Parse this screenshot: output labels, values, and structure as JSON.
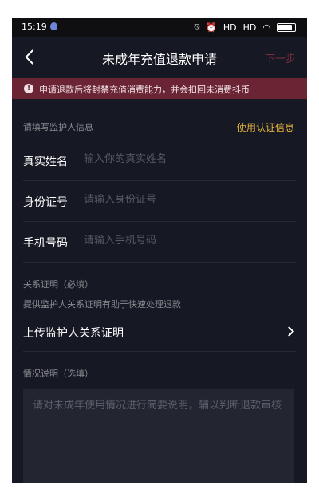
{
  "status_bar": {
    "time": "15:19",
    "signal1": "HD",
    "signal2": "HD"
  },
  "nav": {
    "title": "未成年充值退款申请",
    "next_label": "下一步",
    "back_icon": "chevron-left-icon"
  },
  "warning": {
    "text": "申请退款后将封禁充值消费能力，并会扣回未消费抖币",
    "icon": "!"
  },
  "guardian": {
    "section_label": "请填写监护人信息",
    "use_cert_label": "使用认证信息",
    "fields": [
      {
        "label": "真实姓名",
        "placeholder": "输入你的真实姓名"
      },
      {
        "label": "身份证号",
        "placeholder": "请输入身份证号"
      },
      {
        "label": "手机号码",
        "placeholder": "请输入手机号码"
      }
    ]
  },
  "relation": {
    "title": "关系证明（必填）",
    "hint": "提供监护人关系证明有助于快速处理退款",
    "upload_label": "上传监护人关系证明"
  },
  "situation": {
    "title": "情况说明（选填）",
    "placeholder": "请对未成年使用情况进行简要说明，辅以判断退款审核"
  },
  "colors": {
    "background": "#161823",
    "accent": "#e7b53d",
    "warning_bg": "#6b2434",
    "next_disabled": "#7a2e3f"
  }
}
